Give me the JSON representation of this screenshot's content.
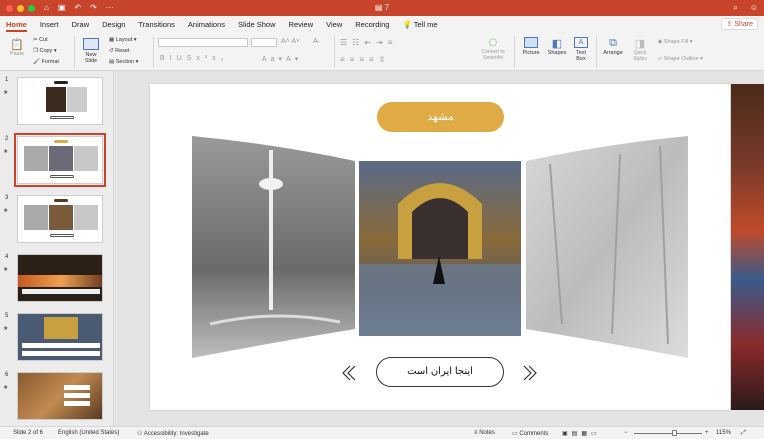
{
  "window": {
    "title": "7"
  },
  "tabs": [
    "Home",
    "Insert",
    "Draw",
    "Design",
    "Transitions",
    "Animations",
    "Slide Show",
    "Review",
    "View",
    "Recording",
    "Tell me"
  ],
  "share_label": "Share",
  "ribbon": {
    "paste": "Paste",
    "cut": "Cut",
    "copy": "Copy",
    "format": "Format",
    "new_slide": "New Slide",
    "layout": "Layout",
    "reset": "Reset",
    "section": "Section",
    "convert": "Convert to SmartArt",
    "picture": "Picture",
    "shapes": "Shapes",
    "text_box": "Text Box",
    "arrange": "Arrange",
    "quick_styles": "Quick Styles",
    "shape_fill": "Shape Fill",
    "shape_outline": "Shape Outline"
  },
  "slides": [
    {
      "num": "1"
    },
    {
      "num": "2"
    },
    {
      "num": "3"
    },
    {
      "num": "4"
    },
    {
      "num": "5"
    },
    {
      "num": "6"
    }
  ],
  "slide": {
    "title": "مشهد",
    "bottom_label": "اینجا ایران است"
  },
  "status": {
    "slide_of": "Slide 2 of 6",
    "language": "English (United States)",
    "accessibility": "Accessibility: Investigate",
    "notes": "Notes",
    "comments": "Comments",
    "zoom": "115%"
  },
  "colors": {
    "accent": "#c8452b",
    "gold": "#e0ab45"
  }
}
